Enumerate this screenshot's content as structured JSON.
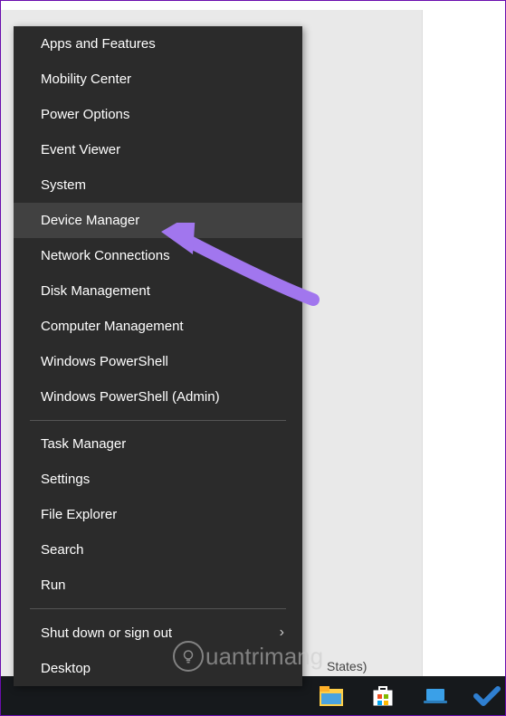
{
  "menu": {
    "groups": [
      {
        "items": [
          {
            "label": "Apps and Features",
            "hovered": false,
            "submenu": false
          },
          {
            "label": "Mobility Center",
            "hovered": false,
            "submenu": false
          },
          {
            "label": "Power Options",
            "hovered": false,
            "submenu": false
          },
          {
            "label": "Event Viewer",
            "hovered": false,
            "submenu": false
          },
          {
            "label": "System",
            "hovered": false,
            "submenu": false
          },
          {
            "label": "Device Manager",
            "hovered": true,
            "submenu": false
          },
          {
            "label": "Network Connections",
            "hovered": false,
            "submenu": false
          },
          {
            "label": "Disk Management",
            "hovered": false,
            "submenu": false
          },
          {
            "label": "Computer Management",
            "hovered": false,
            "submenu": false
          },
          {
            "label": "Windows PowerShell",
            "hovered": false,
            "submenu": false
          },
          {
            "label": "Windows PowerShell (Admin)",
            "hovered": false,
            "submenu": false
          }
        ]
      },
      {
        "items": [
          {
            "label": "Task Manager",
            "hovered": false,
            "submenu": false
          },
          {
            "label": "Settings",
            "hovered": false,
            "submenu": false
          },
          {
            "label": "File Explorer",
            "hovered": false,
            "submenu": false
          },
          {
            "label": "Search",
            "hovered": false,
            "submenu": false
          },
          {
            "label": "Run",
            "hovered": false,
            "submenu": false
          }
        ]
      },
      {
        "items": [
          {
            "label": "Shut down or sign out",
            "hovered": false,
            "submenu": true
          },
          {
            "label": "Desktop",
            "hovered": false,
            "submenu": false
          }
        ]
      }
    ]
  },
  "status_text": "States)",
  "watermark_text": "uantrimang",
  "annotation": {
    "arrow_color": "#a176ee",
    "points_to": "Device Manager"
  },
  "taskbar_icons": [
    {
      "name": "file-explorer-icon"
    },
    {
      "name": "microsoft-store-icon"
    },
    {
      "name": "laptop-icon"
    },
    {
      "name": "tasks-check-icon"
    }
  ]
}
